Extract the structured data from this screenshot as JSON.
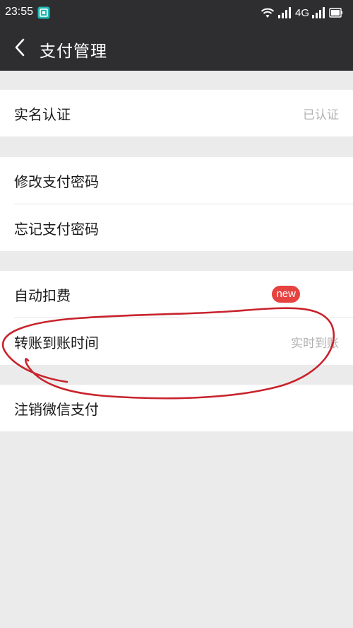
{
  "status_bar": {
    "time": "23:55",
    "network": "4G"
  },
  "nav": {
    "title": "支付管理"
  },
  "groups": [
    {
      "rows": [
        {
          "label": "实名认证",
          "value": "已认证"
        }
      ]
    },
    {
      "rows": [
        {
          "label": "修改支付密码"
        },
        {
          "label": "忘记支付密码"
        }
      ]
    },
    {
      "rows": [
        {
          "label": "自动扣费",
          "badge": "new"
        },
        {
          "label": "转账到账时间",
          "value": "实时到账"
        }
      ]
    },
    {
      "rows": [
        {
          "label": "注销微信支付"
        }
      ]
    }
  ],
  "colors": {
    "header_bg": "#2e2e30",
    "page_bg": "#ebebeb",
    "badge_red": "#e64340",
    "annotation_red": "#c8232c"
  }
}
